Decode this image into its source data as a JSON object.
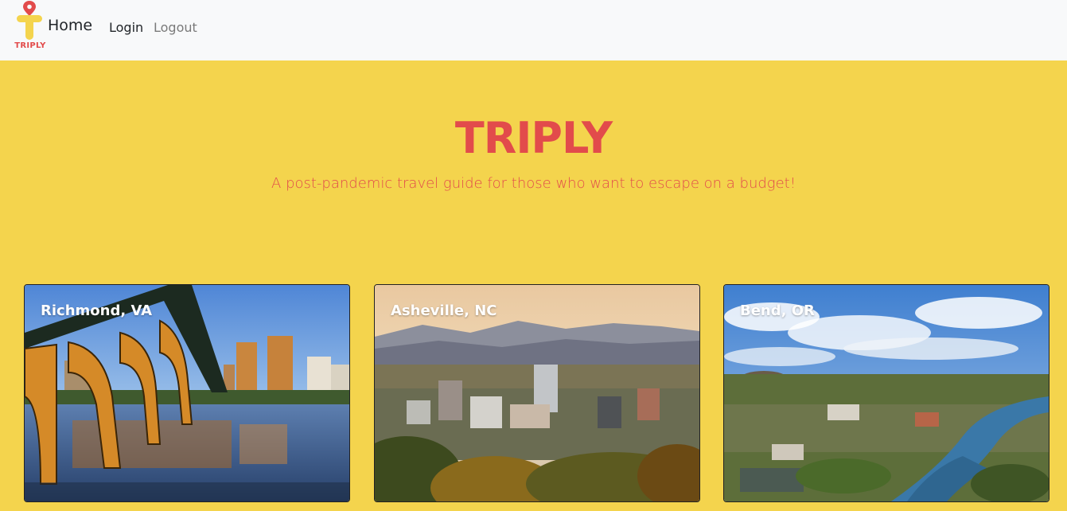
{
  "navbar": {
    "logo_text": "TRIPLY",
    "brand": "Home",
    "links": [
      {
        "label": "Login"
      },
      {
        "label": "Logout"
      }
    ]
  },
  "hero": {
    "title": "TRIPLY",
    "subtitle": "A post-pandemic travel guide for those who want to escape on a budget!"
  },
  "cards": [
    {
      "title": "Richmond, VA"
    },
    {
      "title": "Asheville, NC"
    },
    {
      "title": "Bend, OR"
    }
  ],
  "colors": {
    "background": "#f4d44d",
    "accent": "#e24b4b",
    "navbar": "#f8f9fa"
  }
}
